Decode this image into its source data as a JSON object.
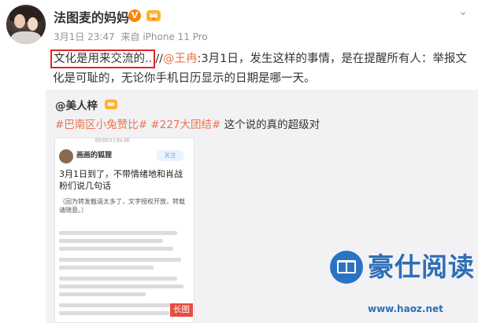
{
  "post": {
    "username": "法图麦的妈妈",
    "verified_badge": "V",
    "timestamp": "3月1日 23:47",
    "source": "来自 iPhone 11 Pro",
    "highlighted_text": "文化是用来交流的",
    "text_after_highlight": "..",
    "separator": "//",
    "mention": "@王冉",
    "text_main": ":3月1日，发生这样的事情，是在提醒所有人：举报文化是可耻的，无论你手机日历显示的日期是哪一天。"
  },
  "repost": {
    "username": "@美人梓",
    "tag1": "#巴南区小兔赞比#",
    "tag2": "#227大团结#",
    "text": " 这个说的真的超级对",
    "thumbnail": {
      "top_text": "画画的狐狸",
      "author": "画画的狐狸",
      "follow_label": "关注",
      "title": "3月1日到了，不带情绪地和肖战粉们说几句话",
      "note": "（因为转发截语太多了，文字授权开放，转载请随意。）",
      "long_image_label": "长图"
    }
  },
  "watermark": {
    "brand": "豪仕阅读",
    "url": "www.haoz.net"
  },
  "colors": {
    "link": "#eb7350",
    "highlight_border": "#e0261e",
    "watermark_blue": "#2d6fb8"
  },
  "icons": {
    "chevron": "chevron-down-icon",
    "crown": "member-crown-icon"
  }
}
